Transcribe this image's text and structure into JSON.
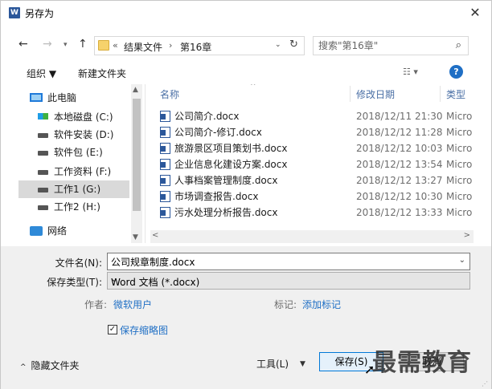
{
  "window": {
    "title": "另存为",
    "app_icon": "W",
    "close": "✕"
  },
  "nav": {
    "back": "←",
    "forward": "→",
    "recent": "▾",
    "up": "↑",
    "breadcrumb_prefix": "«",
    "breadcrumb": [
      "结果文件",
      "第16章"
    ],
    "breadcrumb_sep": "›",
    "dropdown": "⌄",
    "refresh": "↻",
    "search_placeholder": "搜索\"第16章\"",
    "search_icon": "⌕"
  },
  "toolbar": {
    "organize": "组织 ▼",
    "new_folder": "新建文件夹",
    "view": "☷ ▾",
    "help": "?"
  },
  "sidebar": {
    "items": [
      {
        "label": "此电脑",
        "icon": "pc-icon"
      },
      {
        "label": "本地磁盘 (C:)",
        "icon": "windows-drive-icon"
      },
      {
        "label": "软件安装 (D:)",
        "icon": "drive-icon"
      },
      {
        "label": "软件包 (E:)",
        "icon": "drive-icon"
      },
      {
        "label": "工作资料 (F:)",
        "icon": "drive-icon"
      },
      {
        "label": "工作1 (G:)",
        "icon": "drive-icon",
        "selected": true
      },
      {
        "label": "工作2 (H:)",
        "icon": "drive-icon"
      },
      {
        "label": "网络",
        "icon": "network-icon"
      }
    ]
  },
  "filelist": {
    "columns": {
      "name": "名称",
      "date": "修改日期",
      "type": "类型"
    },
    "sort_indicator": "^",
    "files": [
      {
        "name": "公司简介.docx",
        "date": "2018/12/11 21:30",
        "type": "Micro"
      },
      {
        "name": "公司简介-修订.docx",
        "date": "2018/12/12 11:28",
        "type": "Micro"
      },
      {
        "name": "旅游景区项目策划书.docx",
        "date": "2018/12/12 10:03",
        "type": "Micro"
      },
      {
        "name": "企业信息化建设方案.docx",
        "date": "2018/12/12 13:54",
        "type": "Micro"
      },
      {
        "name": "人事档案管理制度.docx",
        "date": "2018/12/12 13:27",
        "type": "Micro"
      },
      {
        "name": "市场调查报告.docx",
        "date": "2018/12/12 10:30",
        "type": "Micro"
      },
      {
        "name": "污水处理分析报告.docx",
        "date": "2018/12/12 13:33",
        "type": "Micro"
      }
    ],
    "scroll_left": "<",
    "scroll_right": ">"
  },
  "form": {
    "filename_label": "文件名(N):",
    "filename_value": "公司规章制度.docx",
    "filetype_label": "保存类型(T):",
    "filetype_value": "Word 文档 (*.docx)",
    "author_label": "作者:",
    "author_value": "微软用户",
    "tags_label": "标记:",
    "tags_value": "添加标记",
    "thumbnail_label": "保存缩略图",
    "thumbnail_checked": "✓"
  },
  "footer": {
    "hide_folders": "隐藏文件夹",
    "hide_chevron": "^",
    "tools": "工具(L)",
    "tools_chevron": "▼",
    "save": "保存(S)",
    "cancel": "取消",
    "watermark": "最需教育"
  }
}
